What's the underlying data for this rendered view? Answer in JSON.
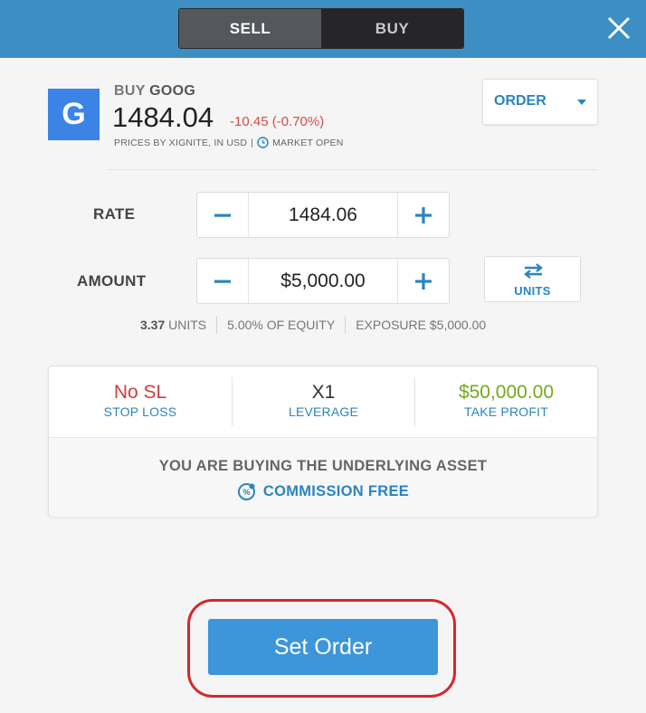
{
  "toggle": {
    "sell_label": "SELL",
    "buy_label": "BUY",
    "selected": "SELL"
  },
  "header": {
    "close_icon": "close-icon"
  },
  "instrument": {
    "logo_letter": "G",
    "action": "BUY",
    "symbol": "GOOG",
    "price": "1484.04",
    "change": "-10.45 (-0.70%)",
    "source": "PRICES BY XIGNITE, IN USD",
    "market_status": "MARKET OPEN",
    "logo_color": "#3b84e6",
    "change_color": "#d84a4a"
  },
  "order_type": {
    "label": "ORDER",
    "icon": "chevron-down-icon"
  },
  "rate": {
    "label": "RATE",
    "value": "1484.06"
  },
  "amount": {
    "label": "AMOUNT",
    "value": "$5,000.00",
    "switch_label": "UNITS"
  },
  "summary": {
    "units_value": "3.37",
    "units_label": "UNITS",
    "equity": "5.00% OF EQUITY",
    "exposure": "EXPOSURE $5,000.00"
  },
  "risk": {
    "stop_loss": {
      "value": "No SL",
      "label": "STOP LOSS",
      "color": "#d23b3b"
    },
    "leverage": {
      "value": "X1",
      "label": "LEVERAGE",
      "color": "#333333"
    },
    "take_profit": {
      "value": "$50,000.00",
      "label": "TAKE PROFIT",
      "color": "#75a820"
    }
  },
  "notice": {
    "heading": "YOU ARE BUYING THE UNDERLYING ASSET",
    "commission": "COMMISSION FREE"
  },
  "submit": {
    "label": "Set Order",
    "accent": "#3d96d9",
    "highlight": "#d9262b"
  }
}
